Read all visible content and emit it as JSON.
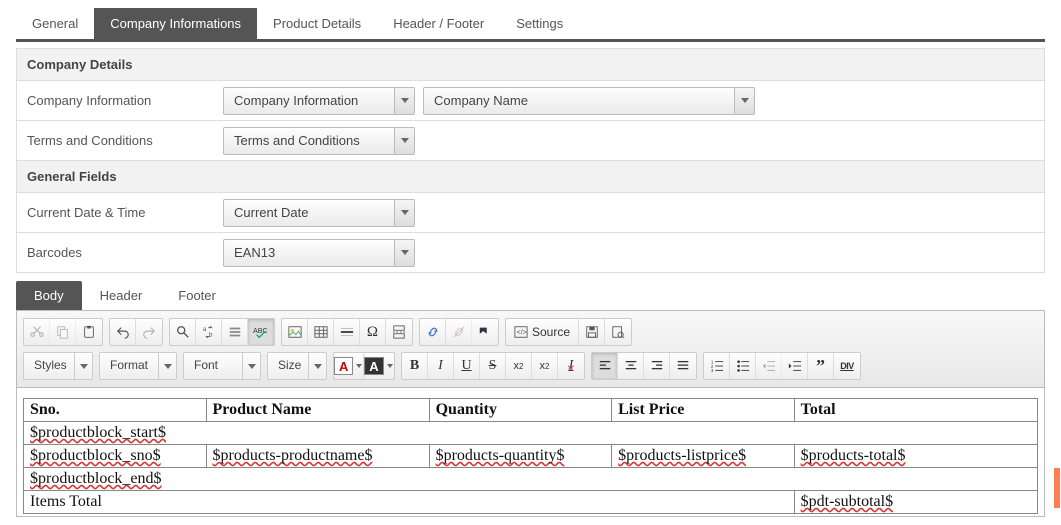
{
  "mainTabs": {
    "general": "General",
    "company": "Company Informations",
    "product": "Product Details",
    "headerFooter": "Header / Footer",
    "settings": "Settings"
  },
  "sections": {
    "companyDetails": "Company Details",
    "generalFields": "General Fields"
  },
  "fields": {
    "companyInfoLabel": "Company Information",
    "companyInfoSelect": "Company Information",
    "companyNameSelect": "Company Name",
    "termsLabel": "Terms and Conditions",
    "termsSelect": "Terms and Conditions",
    "currentDateLabel": "Current Date & Time",
    "currentDateSelect": "Current Date",
    "barcodesLabel": "Barcodes",
    "barcodesSelect": "EAN13"
  },
  "subTabs": {
    "body": "Body",
    "header": "Header",
    "footer": "Footer"
  },
  "toolbar": {
    "source": "Source",
    "styles": "Styles",
    "format": "Format",
    "font": "Font",
    "size": "Size",
    "a": "A"
  },
  "editorTable": {
    "headers": {
      "sno": "Sno.",
      "productName": "Product Name",
      "quantity": "Quantity",
      "listPrice": "List Price",
      "total": "Total"
    },
    "rows": {
      "blockStart": "$productblock_start$",
      "sno": "$productblock_sno$",
      "pname": "$products-productname$",
      "qty": "$products-quantity$",
      "listprice": "$products-listprice$",
      "total": "$products-total$",
      "blockEnd": "$productblock_end$",
      "itemsTotal": "Items Total",
      "subtotal": "$pdt-subtotal$"
    }
  }
}
